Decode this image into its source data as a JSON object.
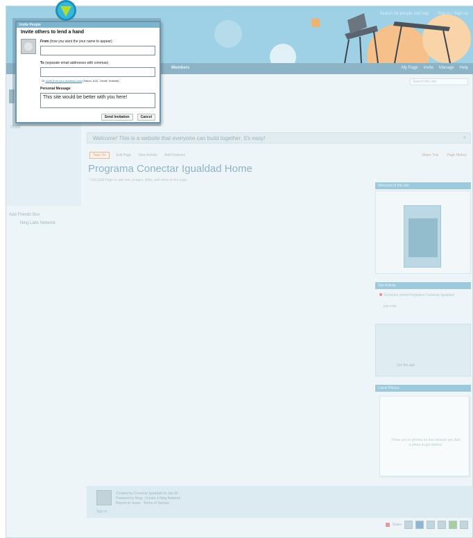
{
  "banner": {
    "top_links": [
      "Search for people and tags",
      "Sign in / Sign up"
    ],
    "colors": {
      "sky": "#9ed0e6",
      "orange": "#f6c08a",
      "nav": "#8cb4c6"
    }
  },
  "navbar": {
    "members_label": "Members",
    "right_items": [
      "My Page",
      "Invite",
      "Manage",
      "Help"
    ]
  },
  "search_mini": {
    "placeholder": "Search this site"
  },
  "left_col": {
    "label": "Invite",
    "link_1": "Add Friends Box",
    "link_2": "Ning Labs Network"
  },
  "welcome_bar": {
    "text": "Welcome! This is a website that everyone can build together. It's easy!",
    "close": "×"
  },
  "sub_actions": {
    "tag_button": "Tags On",
    "items": [
      "Edit Page",
      "View Activity",
      "Add Features"
    ]
  },
  "right_actions": [
    "Share This",
    "Page History"
  ],
  "page": {
    "title": "Programa Conectar Igualdad Home",
    "description": "Click Edit Page to add text, images, links, and more to the page."
  },
  "widgets": {
    "w1_title": "Welcome to this site",
    "w2_title": "Site Activity",
    "w2_line": "Someone joined Programa Conectar Igualdad",
    "w2_sub": "just now",
    "w2_box_text": "Get the app",
    "w3_title": "Latest Photos",
    "w3_text": "There are no photos on this network yet. Add a photo to get started."
  },
  "comment": {
    "line_1": "Created by Conectar Igualdad on Jan 26",
    "line_2": "Powered by Ning · Create a Ning Network",
    "line_3": "Report an Issue · Terms of Service",
    "foot": "Sign in"
  },
  "bottom": {
    "share_label": "Share"
  },
  "dialog": {
    "titlebar": "Invite People",
    "heading": "Invite others to lend a hand",
    "from_label": "From",
    "from_hint": "(how you want the your name to appear)",
    "from_value": "",
    "to_label": "To",
    "to_hint": "(separate email addresses with commas)",
    "to_value": "",
    "helper_prefix": "Or",
    "helper_link": "invite from your address book",
    "helper_suffix": "(Yahoo, AOL, Gmail, Hotmail)",
    "message_label": "Personal Message",
    "message_value": "This site would be better with you here!",
    "send_label": "Send Invitation",
    "cancel_label": "Cancel"
  }
}
